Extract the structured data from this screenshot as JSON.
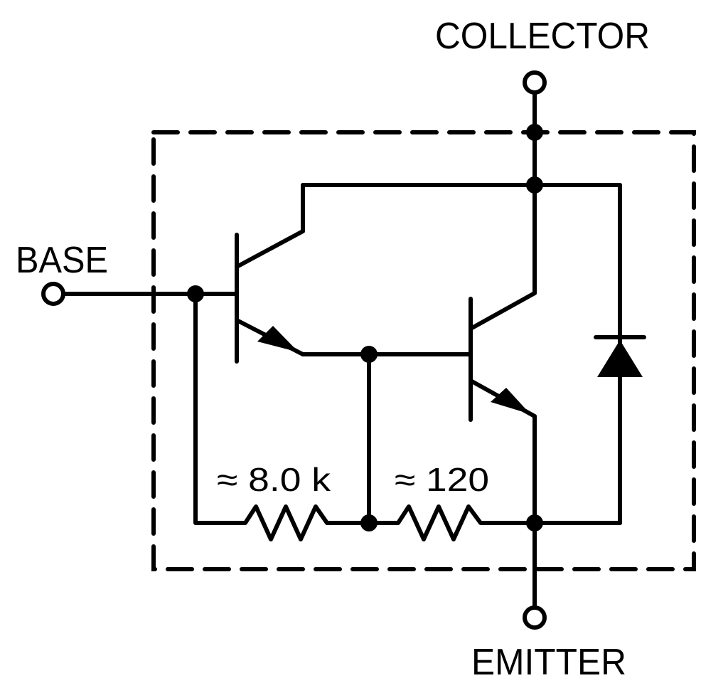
{
  "diagram": {
    "type": "Darlington transistor equivalent circuit",
    "terminals": {
      "collector": "COLLECTOR",
      "base": "BASE",
      "emitter": "EMITTER"
    },
    "resistors": [
      {
        "id": "r1",
        "label": "≈ 8.0 k"
      },
      {
        "id": "r2",
        "label": "≈ 120"
      }
    ],
    "components": [
      "npn-transistor-q1",
      "npn-transistor-q2",
      "diode",
      "resistor-r1",
      "resistor-r2"
    ],
    "colors": {
      "ink": "#000000",
      "background": "#ffffff"
    }
  }
}
